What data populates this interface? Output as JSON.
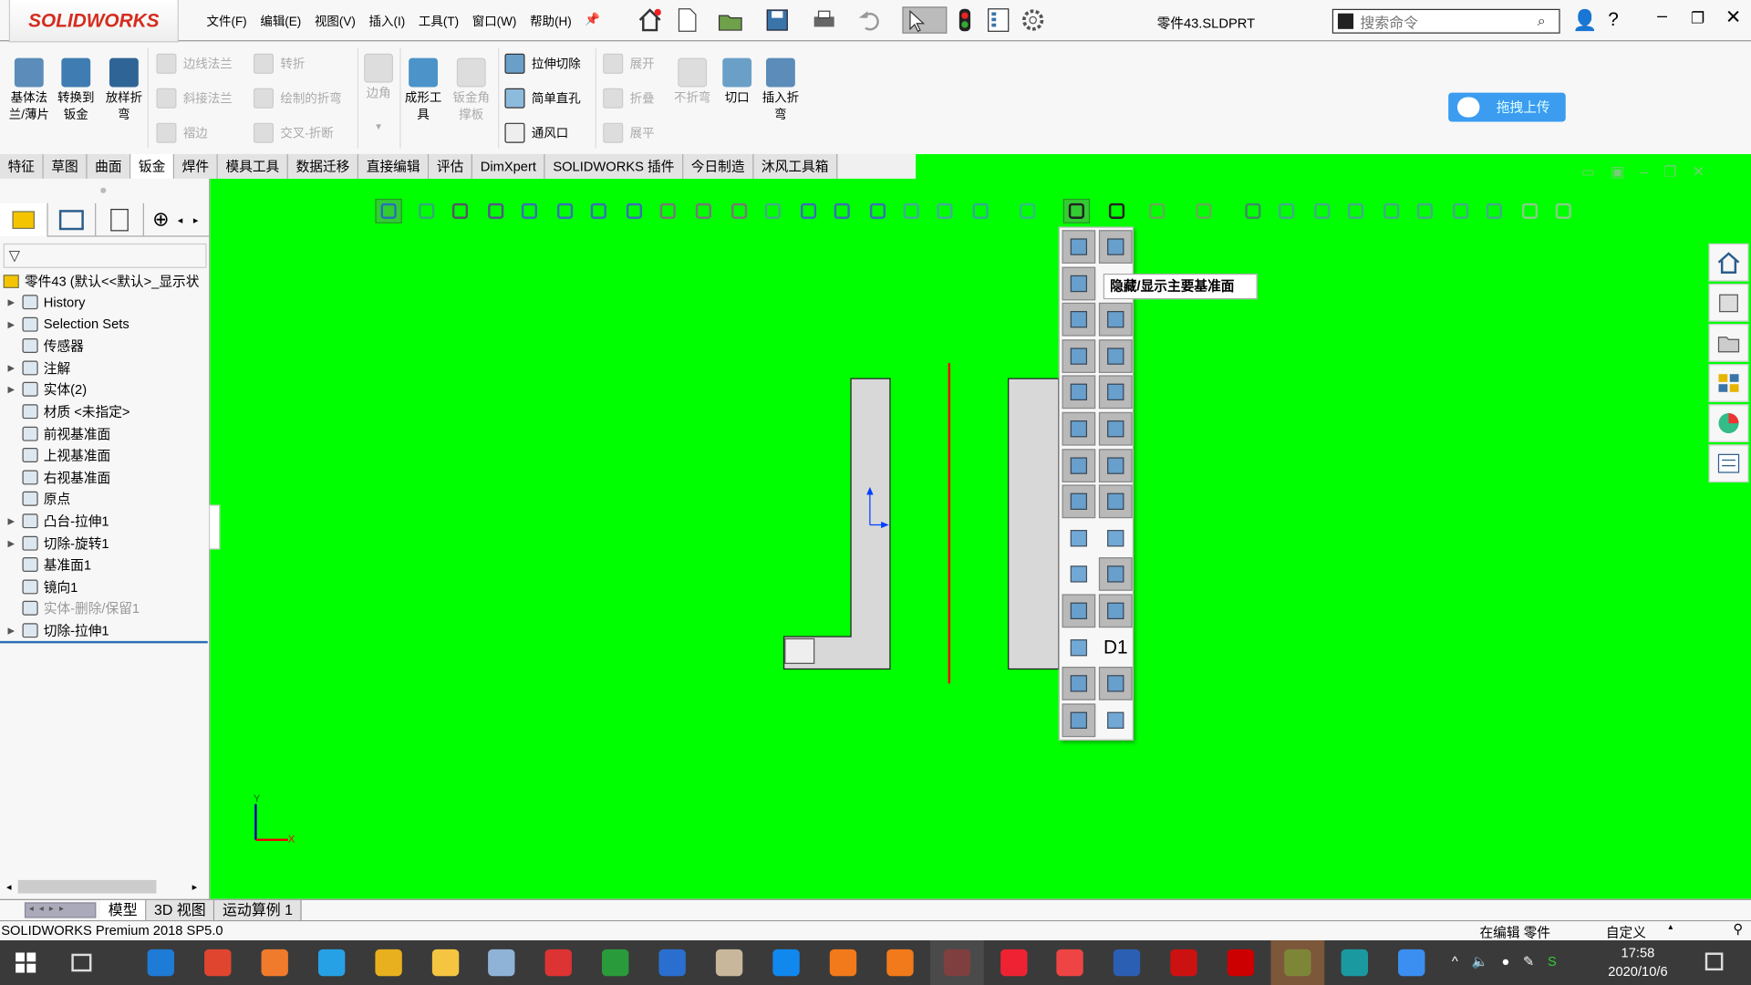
{
  "app": {
    "brand": "SOLIDWORKS",
    "title": "零件43.SLDPRT",
    "search_placeholder": "搜索命令",
    "upload_button": "拖拽上传"
  },
  "menu": [
    "文件(F)",
    "编辑(E)",
    "视图(V)",
    "插入(I)",
    "工具(T)",
    "窗口(W)",
    "帮助(H)"
  ],
  "ribbon": {
    "large": [
      {
        "label": "基体法兰/薄片",
        "enabled": true
      },
      {
        "label": "转换到钣金",
        "enabled": true
      },
      {
        "label": "放样折弯",
        "enabled": true
      },
      {
        "label": "边角",
        "enabled": false
      },
      {
        "label": "成形工具",
        "enabled": true
      },
      {
        "label": "钣金角撑板",
        "enabled": false
      },
      {
        "label": "不折弯",
        "enabled": false
      },
      {
        "label": "切口",
        "enabled": true
      },
      {
        "label": "插入折弯",
        "enabled": true
      }
    ],
    "small": [
      {
        "label": "边线法兰",
        "enabled": false
      },
      {
        "label": "斜接法兰",
        "enabled": false
      },
      {
        "label": "褶边",
        "enabled": false
      },
      {
        "label": "转折",
        "enabled": false
      },
      {
        "label": "绘制的折弯",
        "enabled": false
      },
      {
        "label": "交叉-折断",
        "enabled": false
      },
      {
        "label": "拉伸切除",
        "enabled": true
      },
      {
        "label": "简单直孔",
        "enabled": true
      },
      {
        "label": "通风口",
        "enabled": true
      },
      {
        "label": "展开",
        "enabled": false
      },
      {
        "label": "折叠",
        "enabled": false
      },
      {
        "label": "展平",
        "enabled": false
      }
    ]
  },
  "tabs": [
    {
      "label": "特征"
    },
    {
      "label": "草图"
    },
    {
      "label": "曲面"
    },
    {
      "label": "钣金",
      "active": true
    },
    {
      "label": "焊件"
    },
    {
      "label": "模具工具"
    },
    {
      "label": "数据迁移"
    },
    {
      "label": "直接编辑"
    },
    {
      "label": "评估"
    },
    {
      "label": "DimXpert"
    },
    {
      "label": "SOLIDWORKS 插件"
    },
    {
      "label": "今日制造"
    },
    {
      "label": "沐风工具箱"
    }
  ],
  "tree": {
    "root": "零件43 (默认<<默认>_显示状",
    "items": [
      {
        "label": "History",
        "expandable": true,
        "disabled": false
      },
      {
        "label": "Selection Sets",
        "expandable": true,
        "disabled": false
      },
      {
        "label": "传感器",
        "expandable": false,
        "disabled": false
      },
      {
        "label": "注解",
        "expandable": true,
        "disabled": false
      },
      {
        "label": "实体(2)",
        "expandable": true,
        "disabled": false
      },
      {
        "label": "材质 <未指定>",
        "expandable": false,
        "disabled": false
      },
      {
        "label": "前视基准面",
        "expandable": false,
        "disabled": false
      },
      {
        "label": "上视基准面",
        "expandable": false,
        "disabled": false
      },
      {
        "label": "右视基准面",
        "expandable": false,
        "disabled": false
      },
      {
        "label": "原点",
        "expandable": false,
        "disabled": false
      },
      {
        "label": "凸台-拉伸1",
        "expandable": true,
        "disabled": false
      },
      {
        "label": "切除-旋转1",
        "expandable": true,
        "disabled": false
      },
      {
        "label": "基准面1",
        "expandable": false,
        "disabled": false
      },
      {
        "label": "镜向1",
        "expandable": false,
        "disabled": false
      },
      {
        "label": "实体-删除/保留1",
        "expandable": false,
        "disabled": true
      },
      {
        "label": "切除-拉伸1",
        "expandable": true,
        "disabled": false
      }
    ]
  },
  "tooltip": "隐藏/显示主要基准面",
  "flyout_d1": "D1",
  "bottom_tabs": [
    {
      "label": "模型",
      "active": true
    },
    {
      "label": "3D 视图"
    },
    {
      "label": "运动算例 1"
    }
  ],
  "status": {
    "version": "SOLIDWORKS Premium 2018 SP5.0",
    "mode": "在编辑 零件",
    "custom": "自定义"
  },
  "clock": {
    "time": "17:58",
    "date": "2020/10/6"
  },
  "colors": {
    "viewport": "#00ff00",
    "sketch_line": "#ff0000",
    "brand": "#d52b1e"
  }
}
